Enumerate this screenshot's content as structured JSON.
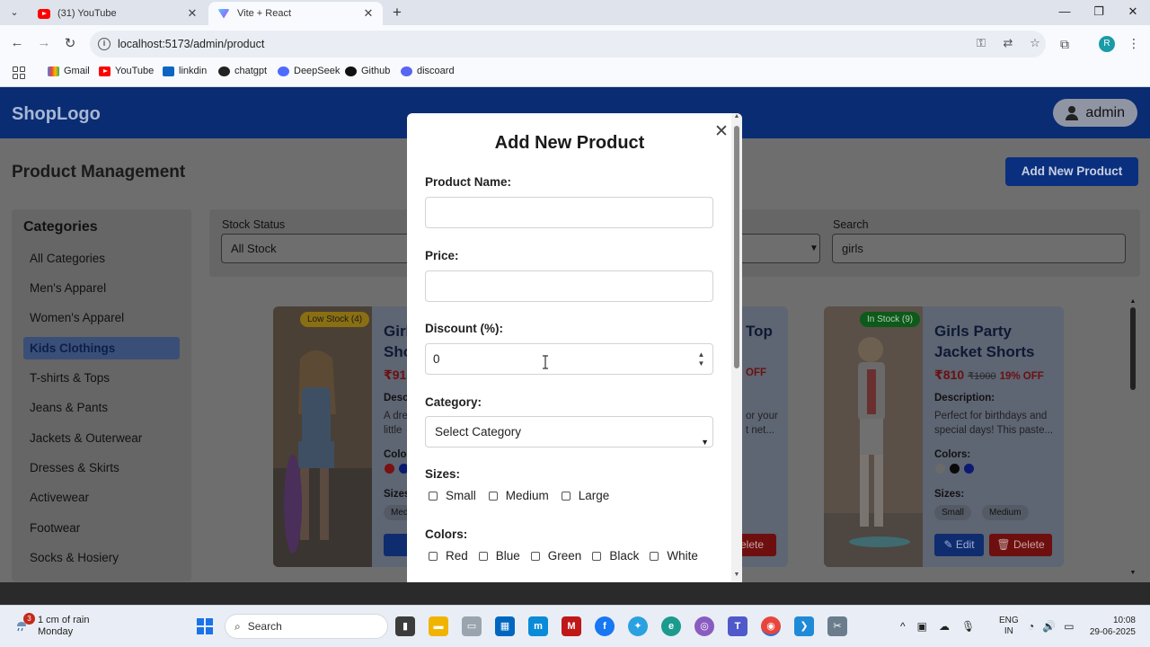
{
  "browser": {
    "tabs": [
      {
        "title": "(31) YouTube",
        "close": "✕"
      },
      {
        "title": "Vite + React",
        "close": "✕"
      }
    ],
    "new_tab": "+",
    "url": "localhost:5173/admin/product",
    "profile_initial": "R",
    "bookmarks": [
      "Gmail",
      "YouTube",
      "linkdin",
      "chatgpt",
      "DeepSeek",
      "Github",
      "discoard"
    ]
  },
  "app": {
    "logo": "ShopLogo",
    "admin_label": "admin",
    "page_title": "Product Management",
    "add_button": "Add New Product",
    "categories_title": "Categories",
    "categories": [
      "All Categories",
      "Men's Apparel",
      "Women's Apparel",
      "Kids Clothings",
      "T-shirts & Tops",
      "Jeans & Pants",
      "Jackets & Outerwear",
      "Dresses & Skirts",
      "Activewear",
      "Footwear",
      "Socks & Hosiery"
    ],
    "active_category": "Kids Clothings",
    "filters": {
      "stock_label": "Stock Status",
      "stock_value": "All Stock",
      "search_label": "Search",
      "search_value": "girls"
    },
    "cards": [
      {
        "badge": "Low Stock (4)",
        "name_partial_1": "Girl",
        "name_partial_2": "Sho",
        "price_partial": "₹91",
        "desc_label_partial": "Desc",
        "desc_partial_1": "A dre",
        "desc_partial_2": "little",
        "colors_label_partial": "Colo",
        "sizes_label_partial": "Sizes",
        "size_partial": "Med",
        "colors": [
          "#7a1010",
          "#0b1a70"
        ]
      },
      {
        "name_partial": "Top",
        "off_partial": "OFF",
        "desc_partial_1": "or your",
        "desc_partial_2": "t net...",
        "delete_partial": "elete"
      },
      {
        "badge": "In Stock (9)",
        "name_line1": "Girls Party",
        "name_line2": "Jacket Shorts",
        "price": "₹810",
        "old_price": "₹1000",
        "discount": "19% OFF",
        "desc_label": "Description:",
        "description": "Perfect for birthdays and special days! This paste...",
        "colors_label": "Colors:",
        "colors": [
          "#6a6a6a",
          "#0a0a0a",
          "#0b1a70"
        ],
        "sizes_label": "Sizes:",
        "sizes": [
          "Small",
          "Medium"
        ],
        "edit": "Edit",
        "delete": "Delete"
      }
    ]
  },
  "modal": {
    "title": "Add New Product",
    "close": "✕",
    "name_label": "Product Name:",
    "name_value": "",
    "price_label": "Price:",
    "price_value": "",
    "discount_label": "Discount (%):",
    "discount_value": "0",
    "category_label": "Category:",
    "category_value": "Select Category",
    "sizes_label": "Sizes:",
    "sizes": [
      "Small",
      "Medium",
      "Large"
    ],
    "colors_label": "Colors:",
    "colors": [
      "Red",
      "Blue",
      "Green",
      "Black",
      "White"
    ]
  },
  "taskbar": {
    "weather_line1": "1 cm of rain",
    "weather_line2": "Monday",
    "weather_badge": "3",
    "search": "Search",
    "lang_line1": "ENG",
    "lang_line2": "IN",
    "time": "10:08",
    "date": "29-06-2025"
  },
  "colors": {
    "header_blue": "#0a2c73",
    "overlay_grey": "#6e6e6e",
    "modal_bg": "#ffffff"
  }
}
